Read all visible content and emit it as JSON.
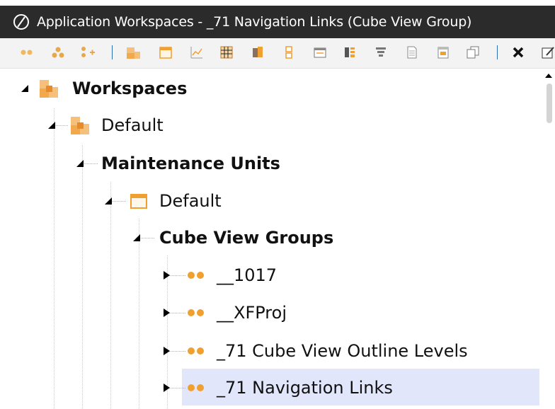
{
  "window": {
    "title": "Application Workspaces - _71 Navigation Links (Cube View Group)"
  },
  "toolbar": {
    "buttons": [
      {
        "icon": "cube-view-group-icon"
      },
      {
        "icon": "cube-view-profile-icon"
      },
      {
        "icon": "add-cube-view-icon"
      },
      {
        "icon": "workspace-icon"
      },
      {
        "icon": "maintenance-unit-icon"
      },
      {
        "icon": "chart-icon"
      },
      {
        "icon": "grid-icon"
      },
      {
        "icon": "book-icon"
      },
      {
        "icon": "stack-icon"
      },
      {
        "icon": "form-icon"
      },
      {
        "icon": "columns-icon"
      },
      {
        "icon": "filter-icon"
      },
      {
        "icon": "document-icon"
      },
      {
        "icon": "dashboard-icon"
      },
      {
        "icon": "copy-icon"
      },
      {
        "icon": "delete-icon"
      },
      {
        "icon": "rename-icon"
      }
    ]
  },
  "tree": {
    "root": {
      "label": "Workspaces"
    },
    "workspace": {
      "label": "Default"
    },
    "maintenance_units": {
      "label": "Maintenance Units"
    },
    "maintenance_unit": {
      "label": "Default"
    },
    "cube_view_groups": {
      "label": "Cube View Groups"
    },
    "items": [
      {
        "label": "__1017"
      },
      {
        "label": "__XFProj"
      },
      {
        "label": "_71 Cube View Outline Levels"
      },
      {
        "label": "_71 Navigation Links",
        "selected": true
      }
    ]
  },
  "colors": {
    "titlebar_bg": "#2b2b2b",
    "selection_bg": "#e1e6fb",
    "accent_orange": "#f0a030",
    "toolbar_separator": "#2d6db5"
  }
}
